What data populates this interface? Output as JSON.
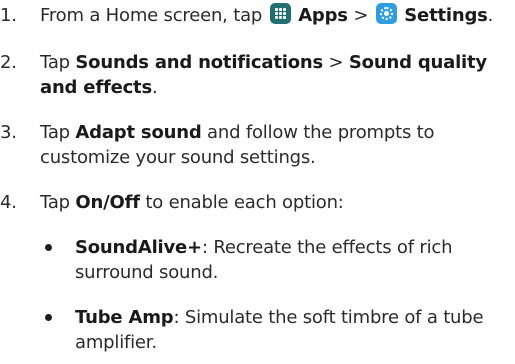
{
  "steps": [
    {
      "num": "1.",
      "pre": "From a Home screen, tap ",
      "apps_icon": "apps-grid-icon",
      "apps_label": "Apps",
      "sep": " > ",
      "settings_icon": "settings-gear-icon",
      "settings_label": "Settings",
      "post": "."
    },
    {
      "num": "2.",
      "pre": "Tap ",
      "b1": "Sounds and notifications",
      "sep": " > ",
      "b2": "Sound quality and effects",
      "post": "."
    },
    {
      "num": "3.",
      "pre": "Tap ",
      "b1": "Adapt sound",
      "post": " and follow the prompts to customize your sound settings."
    },
    {
      "num": "4.",
      "pre": "Tap ",
      "b1": "On/Off",
      "post": " to enable each option:"
    }
  ],
  "options": [
    {
      "name": "SoundAlive+",
      "desc": ": Recreate the effects of rich surround sound."
    },
    {
      "name": "Tube Amp",
      "desc": ": Simulate the soft timbre of a tube amplifier."
    }
  ],
  "colors": {
    "apps_icon_bg": "#1f6f73",
    "settings_icon_bg": "#2e9ee0",
    "text": "#2b2b2b"
  }
}
